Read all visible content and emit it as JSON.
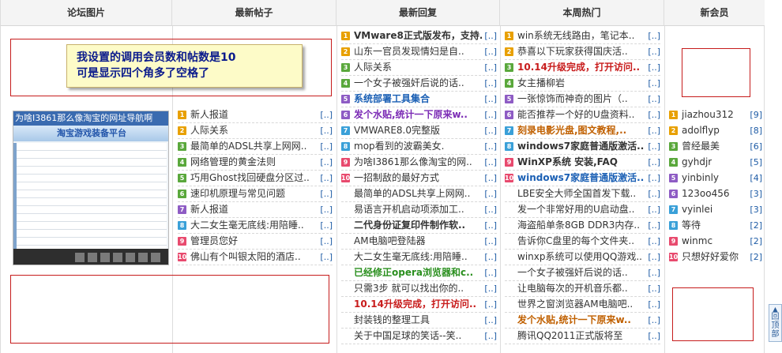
{
  "headers": [
    "论坛图片",
    "最新帖子",
    "最新回复",
    "本周热门",
    "新会员"
  ],
  "note": {
    "line1": "我设置的调用会员数和帖数是10",
    "line2": "可是显示四个角多了空格了"
  },
  "thumbnail": {
    "title": "为啥I3861那么像淘宝的网址导航啊",
    "banner": "淘宝游戏装备平台"
  },
  "more_label": "[..]",
  "latest_posts": [
    {
      "n": "1",
      "c": "#e8a000",
      "title": "新人报道",
      "style": ""
    },
    {
      "n": "2",
      "c": "#e8a000",
      "title": "人际关系",
      "style": ""
    },
    {
      "n": "3",
      "c": "#5aa83c",
      "title": "最简单的ADSL共享上网网..",
      "style": ""
    },
    {
      "n": "4",
      "c": "#5aa83c",
      "title": "网络管理的黄金法则",
      "style": ""
    },
    {
      "n": "5",
      "c": "#5aa83c",
      "title": "巧用Ghost找回硬盘分区过..",
      "style": ""
    },
    {
      "n": "6",
      "c": "#5aa83c",
      "title": "速印机原理与常见问题",
      "style": ""
    },
    {
      "n": "7",
      "c": "#8e5cc4",
      "title": "新人报道",
      "style": ""
    },
    {
      "n": "8",
      "c": "#3aa0d8",
      "title": "大二女生毫无底线:用陪睡..",
      "style": ""
    },
    {
      "n": "9",
      "c": "#e84a6e",
      "title": "管理员您好",
      "style": ""
    },
    {
      "n": "10",
      "c": "#e84a6e",
      "title": "佛山有个叫银太阳的酒店..",
      "style": ""
    }
  ],
  "latest_replies": [
    {
      "n": "1",
      "c": "#e8a000",
      "title": "VMware8正式版发布，支持..",
      "style": "b"
    },
    {
      "n": "2",
      "c": "#e8a000",
      "title": "山东一官员发现情妇是自..",
      "style": ""
    },
    {
      "n": "3",
      "c": "#5aa83c",
      "title": "人际关系",
      "style": ""
    },
    {
      "n": "4",
      "c": "#5aa83c",
      "title": "一个女子被强奸后说的话..",
      "style": ""
    },
    {
      "n": "5",
      "c": "#8e5cc4",
      "title": "系统部署工具集合",
      "style": "blue"
    },
    {
      "n": "6",
      "c": "#8e5cc4",
      "title": "发个水贴,统计一下原来w..",
      "style": "purple"
    },
    {
      "n": "7",
      "c": "#3aa0d8",
      "title": "VMWARE8.0完整版",
      "style": ""
    },
    {
      "n": "8",
      "c": "#3aa0d8",
      "title": "mop看到的波霸美女.",
      "style": ""
    },
    {
      "n": "9",
      "c": "#e84a6e",
      "title": "为啥I3861那么像淘宝的网..",
      "style": ""
    },
    {
      "n": "10",
      "c": "#e84a6e",
      "title": "一招制敌的最好方式",
      "style": ""
    },
    {
      "n": "",
      "c": "",
      "title": "最简单的ADSL共享上网网..",
      "style": ""
    },
    {
      "n": "",
      "c": "",
      "title": "易语言开机启动项添加工..",
      "style": ""
    },
    {
      "n": "",
      "c": "",
      "title": "二代身份证复印件制作软..",
      "style": "b"
    },
    {
      "n": "",
      "c": "",
      "title": "AM电脑吧登陆器",
      "style": ""
    },
    {
      "n": "",
      "c": "",
      "title": "大二女生毫无底线:用陪睡..",
      "style": ""
    },
    {
      "n": "",
      "c": "",
      "title": "已经修正opera浏览器和c..",
      "style": "green"
    },
    {
      "n": "",
      "c": "",
      "title": "只需3步 就可以找出你的..",
      "style": ""
    },
    {
      "n": "",
      "c": "",
      "title": "10.14升级完成，打开访问..",
      "style": "red"
    },
    {
      "n": "",
      "c": "",
      "title": "封装钱的整理工具",
      "style": ""
    },
    {
      "n": "",
      "c": "",
      "title": "关于中国足球的笑话--笑..",
      "style": ""
    }
  ],
  "weekly_hot": [
    {
      "n": "1",
      "c": "#e8a000",
      "title": "win系统无线路由，笔记本..",
      "style": ""
    },
    {
      "n": "2",
      "c": "#e8a000",
      "title": "恭喜以下玩家获得国庆活..",
      "style": ""
    },
    {
      "n": "3",
      "c": "#5aa83c",
      "title": "10.14升级完成，打开访问..",
      "style": "red"
    },
    {
      "n": "4",
      "c": "#5aa83c",
      "title": "女主播柳岩",
      "style": ""
    },
    {
      "n": "5",
      "c": "#8e5cc4",
      "title": "一张惊饰而神奇的图片（..",
      "style": ""
    },
    {
      "n": "6",
      "c": "#8e5cc4",
      "title": "能否推荐一个好的U盘资料..",
      "style": ""
    },
    {
      "n": "7",
      "c": "#3aa0d8",
      "title": "刻录电影光盘,图文教程,..",
      "style": "orange"
    },
    {
      "n": "8",
      "c": "#3aa0d8",
      "title": "windows7家庭普通版激活..",
      "style": "b"
    },
    {
      "n": "9",
      "c": "#e84a6e",
      "title": "WinXP系统 安装,FAQ",
      "style": "b"
    },
    {
      "n": "10",
      "c": "#e84a6e",
      "title": "windows7家庭普通版激活..",
      "style": "blue"
    },
    {
      "n": "",
      "c": "",
      "title": "LBE安全大师全国首发下载..",
      "style": ""
    },
    {
      "n": "",
      "c": "",
      "title": "发一个非常好用的U启动盘..",
      "style": ""
    },
    {
      "n": "",
      "c": "",
      "title": "海盗船单条8GB DDR3内存..",
      "style": ""
    },
    {
      "n": "",
      "c": "",
      "title": "告诉你C盘里的每个文件夹..",
      "style": ""
    },
    {
      "n": "",
      "c": "",
      "title": "winxp系统可以使用QQ游戏..",
      "style": ""
    },
    {
      "n": "",
      "c": "",
      "title": "一个女子被强奸后说的话..",
      "style": ""
    },
    {
      "n": "",
      "c": "",
      "title": "让电脑每次的开机音乐都..",
      "style": ""
    },
    {
      "n": "",
      "c": "",
      "title": "世界之窗浏览器AM电脑吧..",
      "style": ""
    },
    {
      "n": "",
      "c": "",
      "title": "发个水贴,统计一下原来w..",
      "style": "orange"
    },
    {
      "n": "",
      "c": "",
      "title": "腾讯QQ2011正式版将至",
      "style": ""
    }
  ],
  "new_members": [
    {
      "n": "1",
      "c": "#e8a000",
      "name": "jiazhou312",
      "count": "[9]"
    },
    {
      "n": "2",
      "c": "#e8a000",
      "name": "adolflyp",
      "count": "[8]"
    },
    {
      "n": "3",
      "c": "#5aa83c",
      "name": "曾经最美",
      "count": "[6]"
    },
    {
      "n": "4",
      "c": "#5aa83c",
      "name": "gyhdjr",
      "count": "[5]"
    },
    {
      "n": "5",
      "c": "#8e5cc4",
      "name": "yinbinly",
      "count": "[4]"
    },
    {
      "n": "6",
      "c": "#8e5cc4",
      "name": "123oo456",
      "count": "[3]"
    },
    {
      "n": "7",
      "c": "#3aa0d8",
      "name": "vyinlei",
      "count": "[3]"
    },
    {
      "n": "8",
      "c": "#3aa0d8",
      "name": "等待",
      "count": "[2]"
    },
    {
      "n": "9",
      "c": "#e84a6e",
      "name": "winmc",
      "count": "[2]"
    },
    {
      "n": "10",
      "c": "#e84a6e",
      "name": "只想好好爱你",
      "count": "[2]"
    }
  ],
  "back_to_top": "回顶部"
}
